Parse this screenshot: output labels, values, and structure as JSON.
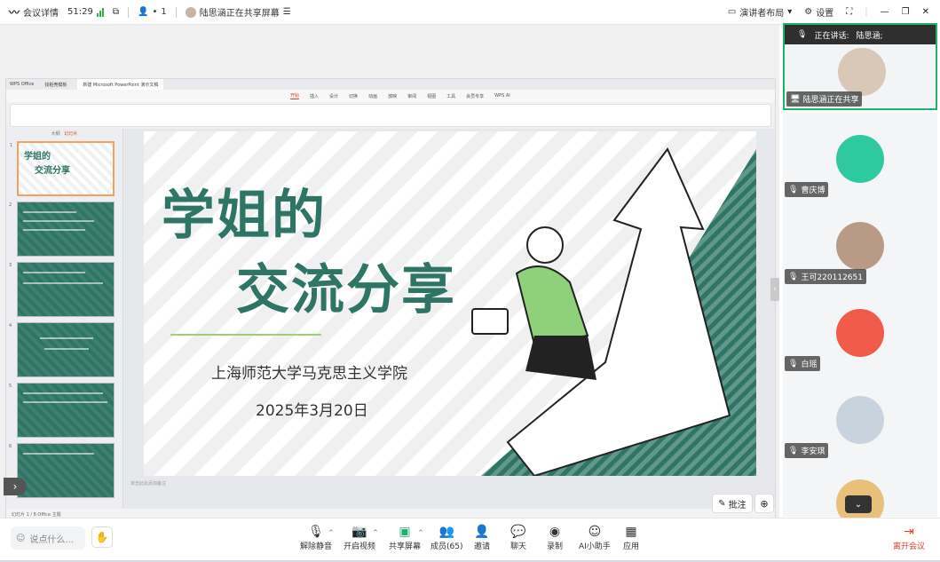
{
  "topbar": {
    "meeting_info": "会议详情",
    "duration": "51:29",
    "participants_count": "1",
    "sharing_status": "陆思涵正在共享屏幕",
    "presenter_layout": "演讲者布局",
    "settings": "设置"
  },
  "presentation": {
    "tabs": [
      "WPS Office",
      "找稻壳模板",
      "新建 Microsoft PowerPoint 演示文稿"
    ],
    "menu": [
      "开始",
      "插入",
      "设计",
      "切换",
      "动画",
      "放映",
      "审阅",
      "视图",
      "工具",
      "会员专享",
      "WPS AI"
    ],
    "active_menu": "开始",
    "outline_label": "大纲",
    "slide_label": "幻灯片",
    "slide_numbers": [
      "1",
      "2",
      "3",
      "4",
      "5",
      "6"
    ],
    "thumb_title_1": "学姐的",
    "thumb_title_2": "交流分享",
    "slide": {
      "title_line1": "学姐的",
      "title_line2": "交流分享",
      "subtitle": "上海师范大学马克思主义学院",
      "date": "2025年3月20日"
    },
    "status": "幻灯片 1 / 8   Office 主题",
    "notes_placeholder": "单击此处添加备注"
  },
  "annotate_label": "批注",
  "participants": {
    "speaking_label": "正在讲话:",
    "speaking_name": "陆思涵;",
    "items": [
      {
        "name": "陆思涵正在共享",
        "avatar_color": "#d9c7b8"
      },
      {
        "name": "曹庆博",
        "avatar_color": "#2fc9a0"
      },
      {
        "name": "王可220112651",
        "avatar_color": "#b89a86"
      },
      {
        "name": "白瑶",
        "avatar_color": "#f25b4a"
      },
      {
        "name": "李安琪",
        "avatar_color": "#c9d3dd"
      }
    ]
  },
  "toolbar": {
    "chat_placeholder": "说点什么...",
    "tools": [
      "解除静音",
      "开启视频",
      "共享屏幕",
      "成员(65)",
      "邀请",
      "聊天",
      "录制",
      "AI小助手",
      "应用"
    ],
    "leave": "离开会议"
  },
  "colors": {
    "slide_green": "#2e7566",
    "active_border": "#20b26b",
    "leave_red": "#e0412c"
  }
}
